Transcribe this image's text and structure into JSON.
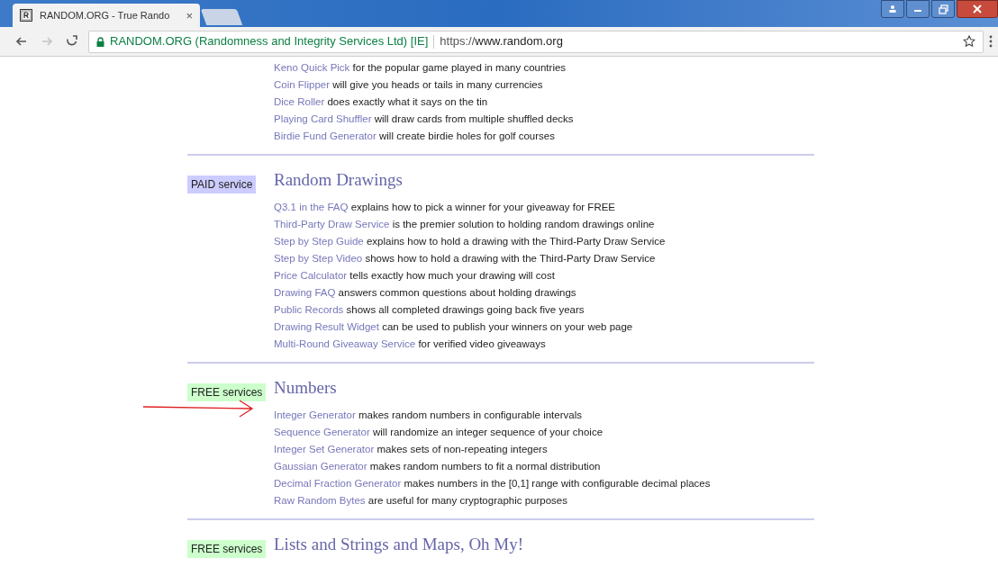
{
  "browser": {
    "tab": {
      "title": "RANDOM.ORG - True Rando",
      "close": "×"
    },
    "nav": [
      {
        "kind": "back",
        "disabled": false
      },
      {
        "kind": "forward",
        "disabled": true
      },
      {
        "kind": "reload",
        "disabled": false
      }
    ],
    "address": {
      "identity": "RANDOM.ORG (Randomness and Integrity Services Ltd) [IE]",
      "scheme": "https://",
      "host": "www.random.org"
    }
  },
  "sections": [
    {
      "items": [
        {
          "link": "Keno Quick Pick",
          "text": "for the popular game played in many countries"
        },
        {
          "link": "Coin Flipper",
          "text": "will give you heads or tails in many currencies"
        },
        {
          "link": "Dice Roller",
          "text": "does exactly what it says on the tin"
        },
        {
          "link": "Playing Card Shuffler",
          "text": "will draw cards from multiple shuffled decks"
        },
        {
          "link": "Birdie Fund Generator",
          "text": "will create birdie holes for golf courses"
        }
      ]
    },
    {
      "badge": {
        "kind": "paid",
        "label": "PAID service"
      },
      "heading": "Random Drawings",
      "items": [
        {
          "link": "Q3.1 in the FAQ",
          "text": "explains how to pick a winner for your giveaway for FREE"
        },
        {
          "link": "Third-Party Draw Service",
          "text": "is the premier solution to holding random drawings online"
        },
        {
          "link": "Step by Step Guide",
          "text": "explains how to hold a drawing with the Third-Party Draw Service"
        },
        {
          "link": "Step by Step Video",
          "text": "shows how to hold a drawing with the Third-Party Draw Service"
        },
        {
          "link": "Price Calculator",
          "text": "tells exactly how much your drawing will cost"
        },
        {
          "link": "Drawing FAQ",
          "text": "answers common questions about holding drawings"
        },
        {
          "link": "Public Records",
          "text": "shows all completed drawings going back five years"
        },
        {
          "link": "Drawing Result Widget",
          "text": "can be used to publish your winners on your web page"
        },
        {
          "link": "Multi-Round Giveaway Service",
          "text": "for verified video giveaways"
        }
      ]
    },
    {
      "badge": {
        "kind": "free",
        "label": "FREE services"
      },
      "heading": "Numbers",
      "items": [
        {
          "link": "Integer Generator",
          "text": "makes random numbers in configurable intervals",
          "pointed": true
        },
        {
          "link": "Sequence Generator",
          "text": "will randomize an integer sequence of your choice",
          "pointed": false
        },
        {
          "link": "Integer Set Generator",
          "text": "makes sets of non-repeating integers",
          "pointed": false
        },
        {
          "link": "Gaussian Generator",
          "text": "makes random numbers to fit a normal distribution",
          "pointed": false
        },
        {
          "link": "Decimal Fraction Generator",
          "text": "makes numbers in the [0,1] range with configurable decimal places",
          "pointed": false
        },
        {
          "link": "Raw Random Bytes",
          "text": "are useful for many cryptographic purposes",
          "pointed": false
        }
      ]
    },
    {
      "badge": {
        "kind": "free",
        "label": "FREE services"
      },
      "heading": "Lists and Strings and Maps, Oh My!"
    }
  ]
}
